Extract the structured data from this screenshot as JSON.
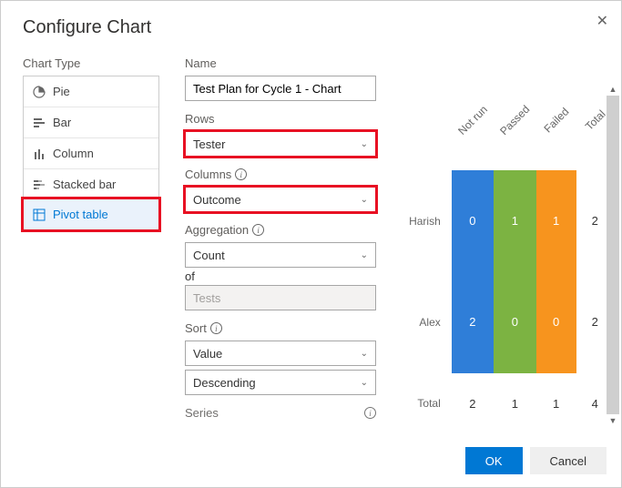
{
  "dialog": {
    "title": "Configure Chart",
    "chart_type_label": "Chart Type",
    "types": [
      {
        "label": "Pie",
        "icon": "pie-icon"
      },
      {
        "label": "Bar",
        "icon": "bar-icon"
      },
      {
        "label": "Column",
        "icon": "column-icon"
      },
      {
        "label": "Stacked bar",
        "icon": "stacked-bar-icon"
      },
      {
        "label": "Pivot table",
        "icon": "pivot-table-icon"
      }
    ],
    "fields": {
      "name_label": "Name",
      "name_value": "Test Plan for Cycle 1 - Chart",
      "rows_label": "Rows",
      "rows_value": "Tester",
      "columns_label": "Columns",
      "columns_value": "Outcome",
      "aggregation_label": "Aggregation",
      "aggregation_value": "Count",
      "of_label": "of",
      "of_value": "Tests",
      "sort_label": "Sort",
      "sort_field": "Value",
      "sort_dir": "Descending",
      "series_label": "Series"
    },
    "footer": {
      "ok": "OK",
      "cancel": "Cancel"
    }
  },
  "chart_data": {
    "type": "table",
    "title": "Test Plan for Cycle 1 - Chart",
    "row_field": "Tester",
    "column_field": "Outcome",
    "columns": [
      "Not run",
      "Passed",
      "Failed",
      "Total"
    ],
    "rows": [
      "Harish",
      "Alex",
      "Total"
    ],
    "values": [
      [
        0,
        1,
        1,
        2
      ],
      [
        2,
        0,
        0,
        2
      ],
      [
        2,
        1,
        1,
        4
      ]
    ],
    "column_colors": [
      "#2f7ed8",
      "#7cb342",
      "#f7941e",
      null
    ]
  }
}
